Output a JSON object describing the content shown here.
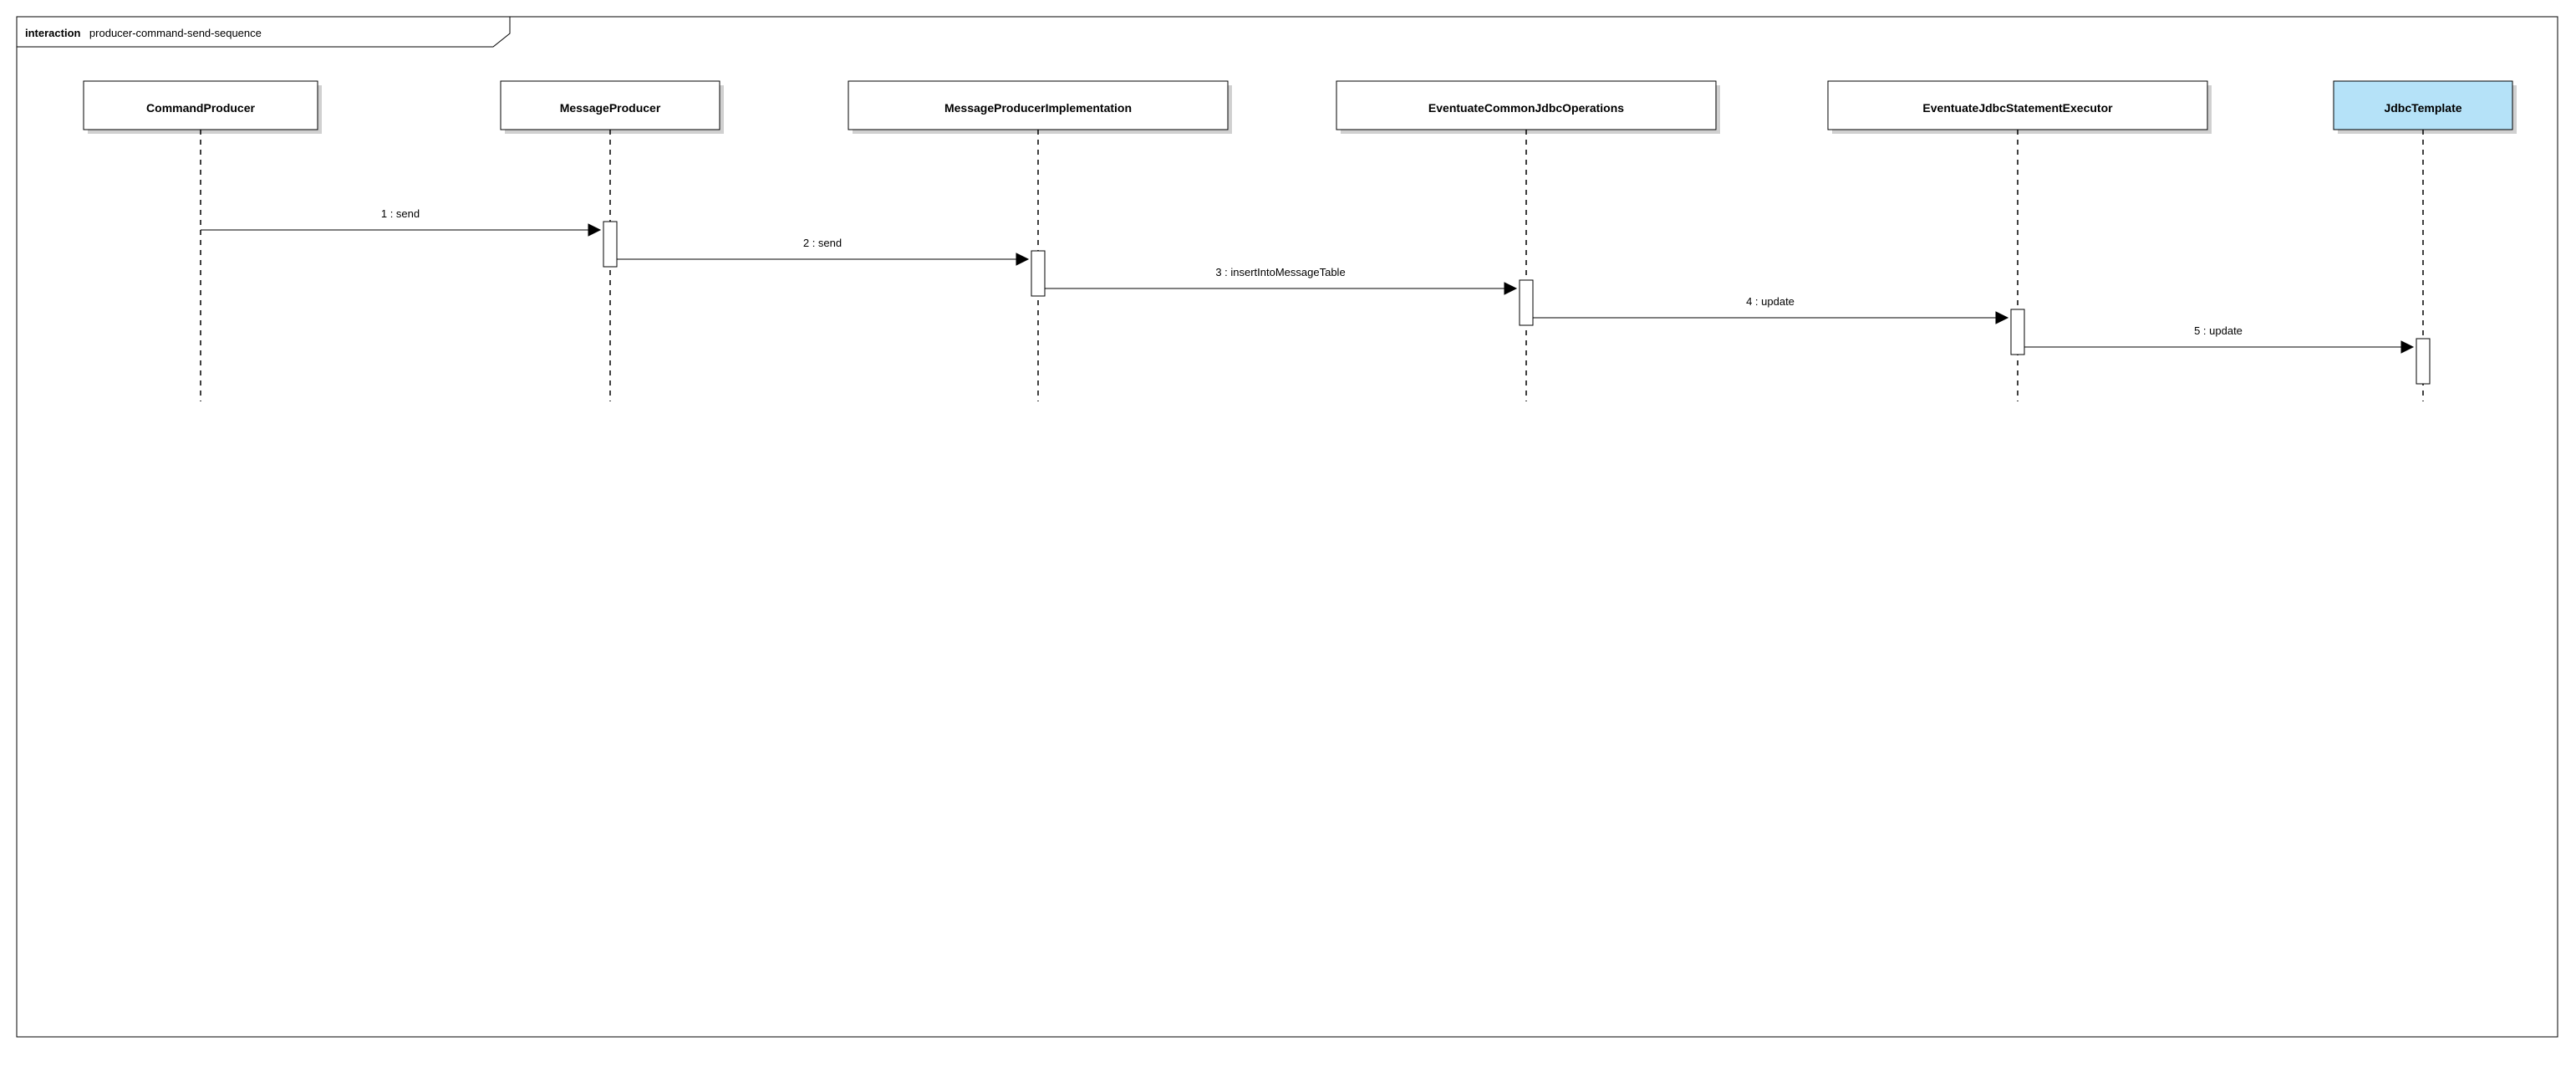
{
  "frame": {
    "label_keyword": "interaction",
    "label_name": "producer-command-send-sequence"
  },
  "participants": [
    {
      "name": "CommandProducer",
      "highlight": false
    },
    {
      "name": "MessageProducer",
      "highlight": false
    },
    {
      "name": "MessageProducerImplementation",
      "highlight": false
    },
    {
      "name": "EventuateCommonJdbcOperations",
      "highlight": false
    },
    {
      "name": "EventuateJdbcStatementExecutor",
      "highlight": false
    },
    {
      "name": "JdbcTemplate",
      "highlight": true
    }
  ],
  "messages": [
    {
      "label": "1 : send"
    },
    {
      "label": "2 : send"
    },
    {
      "label": "3 : insertIntoMessageTable"
    },
    {
      "label": "4 : update"
    },
    {
      "label": "5 : update"
    }
  ]
}
